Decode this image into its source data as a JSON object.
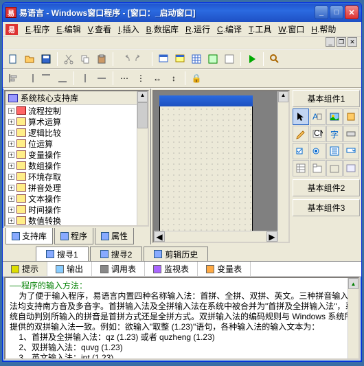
{
  "title": "易语言 - Windows窗口程序 - [窗口：_启动窗口]",
  "menus": [
    "E.程序",
    "E.编辑",
    "V.查看",
    "I.插入",
    "B.数据库",
    "R.运行",
    "C.编译",
    "T.工具",
    "W.窗口",
    "H.帮助"
  ],
  "tree": {
    "root": "系统核心支持库",
    "items": [
      {
        "icon": "▶",
        "label": "流程控制",
        "red": true
      },
      {
        "icon": "√x",
        "label": "算术运算"
      },
      {
        "icon": "?",
        "label": "逻辑比较"
      },
      {
        "icon": "0+1",
        "label": "位运算"
      },
      {
        "icon": "↓x",
        "label": "变量操作"
      },
      {
        "icon": "↓[]",
        "label": "数组操作"
      },
      {
        "icon": "↓[]",
        "label": "环境存取"
      },
      {
        "icon": "↓[]",
        "label": "拼音处理"
      },
      {
        "icon": "↓[]",
        "label": "文本操作"
      },
      {
        "icon": "↓[]",
        "label": "时间操作"
      },
      {
        "icon": "↓[]",
        "label": "数值转换"
      }
    ]
  },
  "leftTabs": [
    {
      "label": "支持库",
      "active": true
    },
    {
      "label": "程序",
      "active": false
    },
    {
      "label": "属性",
      "active": false
    }
  ],
  "rightPanel": {
    "tab1": "基本组件1",
    "tab2": "基本组件2",
    "tab3": "基本组件3"
  },
  "bottomTabs1": [
    {
      "label": "搜寻1",
      "active": true
    },
    {
      "label": "搜寻2",
      "active": false
    },
    {
      "label": "剪辑历史",
      "active": false
    }
  ],
  "bottomTabs2": [
    {
      "label": "提示",
      "active": true,
      "color": "#dd0"
    },
    {
      "label": "输出",
      "active": false,
      "color": "#8cf"
    },
    {
      "label": "调用表",
      "active": false,
      "color": "#888"
    },
    {
      "label": "监视表",
      "active": false,
      "color": "#a6f"
    },
    {
      "label": "变量表",
      "active": false,
      "color": "#fa4"
    }
  ],
  "output": {
    "heading": "──程序的输入方法：",
    "body": "    为了便于输入程序，易语言内置四种名称输入法：首拼、全拼、双拼、英文。三种拼音输入法均支持南方音及多音字。首拼输入法及全拼输入法在系统中被合并为\"首拼及全拼输入法\"，系统自动判别所输入的拼音是首拼方式还是全拼方式。双拼输入法的编码规则与 Windows 系统所提供的双拼输入法一致。例如：欲输入\"取整 (1.23)\"语句，各种输入法的输入文本为：\n    1、首拼及全拼输入法：qz (1.23) 或者 quzheng (1.23)\n    2、双拼输入法：quvg (1.23)\n    3、英文输入法：int (1.23)"
  }
}
